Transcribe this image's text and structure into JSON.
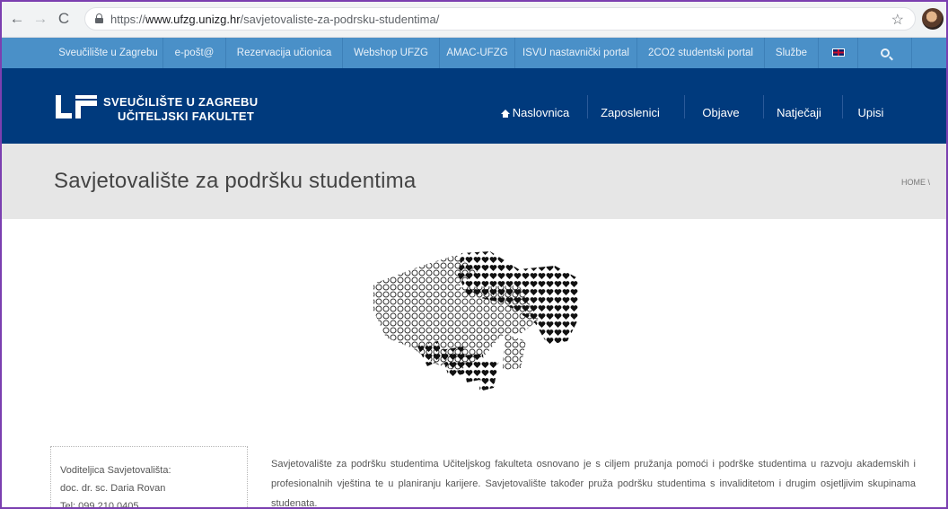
{
  "browser": {
    "url_scheme": "https://",
    "url_host": "www.ufzg.unizg.hr",
    "url_path": "/savjetovaliste-za-podrsku-studentima/"
  },
  "topbar": {
    "items": [
      "Sveučilište u Zagrebu",
      "e-pošt@",
      "Rezervacija učionica",
      "Webshop UFZG",
      "AMAC-UFZG",
      "ISVU nastavnički portal",
      "2CO2 studentski portal",
      "Službe"
    ],
    "lang_icon": "uk-flag-icon",
    "search_icon": "search-icon",
    "color": "#4a90c8"
  },
  "header": {
    "logo_line1": "SVEUČILIŠTE U ZAGREBU",
    "logo_line2": "UČITELJSKI FAKULTET",
    "nav": [
      "Naslovnica",
      "Zaposlenici",
      "Objave",
      "Natječaji",
      "Upisi"
    ],
    "color": "#003a7d"
  },
  "page": {
    "title": "Savjetovalište za podršku studentima",
    "breadcrumb": "HOME \\"
  },
  "infobox": {
    "line1": "Voditeljica Savjetovališta:",
    "line2": "doc. dr. sc. Daria Rovan",
    "line3": "Tel: 099 210 0405"
  },
  "intro": {
    "text": "Savjetovalište za podršku studentima Učiteljskog fakulteta osnovano je s ciljem pružanja pomoći i podrške studentima u razvoju akademskih i profesionalnih vještina te u planiranju karijere. Savjetovalište također pruža podršku studentima s invaliditetom i drugim osjetljivim skupinama studenata."
  }
}
